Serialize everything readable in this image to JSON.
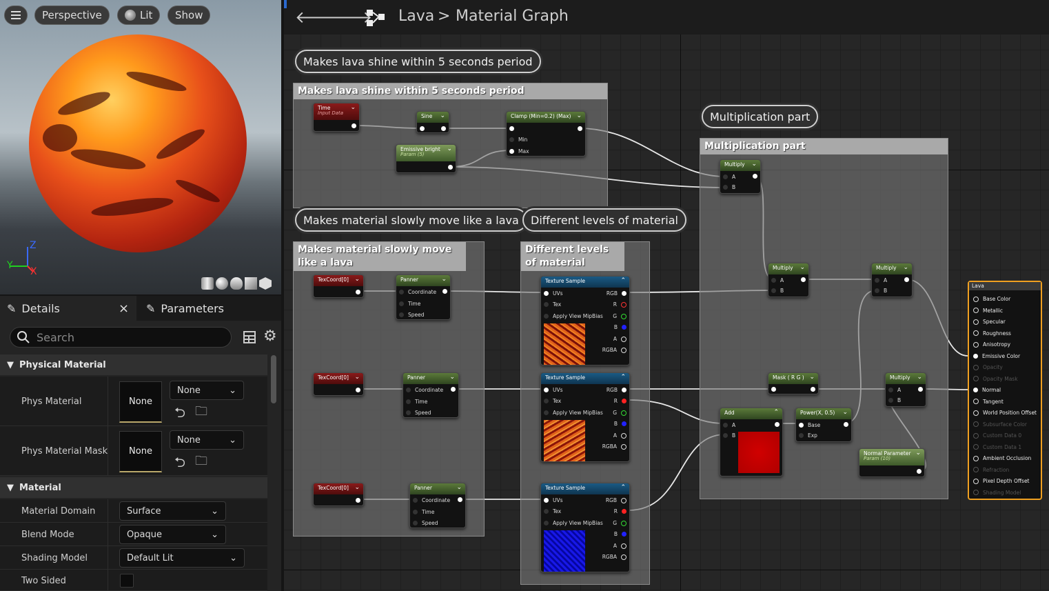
{
  "viewport": {
    "menu_icon": "hamburger-icon",
    "perspective_label": "Perspective",
    "lit_label": "Lit",
    "show_label": "Show",
    "axis": {
      "z": "Z",
      "y": "Y",
      "x": "X"
    }
  },
  "details": {
    "details_tab": "Details",
    "close_glyph": "×",
    "parameters_tab": "Parameters",
    "search_placeholder": "Search",
    "sections": {
      "physical": "Physical Material",
      "material": "Material"
    },
    "props": {
      "phys_material": {
        "label": "Phys Material",
        "thumb": "None",
        "value": "None"
      },
      "phys_material_mask": {
        "label": "Phys Material Mask",
        "thumb": "None",
        "value": "None"
      },
      "material_domain": {
        "label": "Material Domain",
        "value": "Surface"
      },
      "blend_mode": {
        "label": "Blend Mode",
        "value": "Opaque"
      },
      "shading_model": {
        "label": "Shading Model",
        "value": "Default Lit"
      },
      "two_sided": {
        "label": "Two Sided",
        "checked": false
      }
    }
  },
  "graph": {
    "crumb_asset": "Lava",
    "crumb_sep": ">",
    "crumb_page": "Material Graph",
    "comments": {
      "shine": "Makes lava shine within 5 seconds period",
      "mult": "Multiplication part",
      "move": "Makes material slowly move like a lava",
      "levels": "Different levels of material",
      "move_head": "Makes material slowly move like a lava",
      "levels_head": "Different levels of material"
    },
    "nodes": {
      "time": {
        "title": "Time",
        "sub": "Input Data"
      },
      "sine": {
        "title": "Sine"
      },
      "clamp": {
        "title": "Clamp (Min=0.2) (Max)",
        "min": "Min",
        "max": "Max"
      },
      "emissive": {
        "title": "Emissive bright",
        "sub": "Param (5)"
      },
      "texcoord": "TexCoord[0]",
      "panner": {
        "title": "Panner",
        "coordinate": "Coordinate",
        "time": "Time",
        "speed": "Speed"
      },
      "texsample": {
        "title": "Texture Sample",
        "uvs": "UVs",
        "tex": "Tex",
        "mip": "Apply View MipBias",
        "rgb": "RGB",
        "r": "R",
        "g": "G",
        "b": "B",
        "a": "A",
        "rgba": "RGBA"
      },
      "multiply": {
        "title": "Multiply",
        "a": "A",
        "b": "B"
      },
      "mask": {
        "title": "Mask ( R G )"
      },
      "add": {
        "title": "Add",
        "a": "A",
        "b": "B"
      },
      "power": {
        "title": "Power(X, 0.5)",
        "base": "Base",
        "exp": "Exp"
      },
      "normal_param": {
        "title": "Normal Parameter",
        "sub": "Param (10)"
      }
    },
    "result": {
      "title": "Lava",
      "inputs": [
        "Base Color",
        "Metallic",
        "Specular",
        "Roughness",
        "Anisotropy",
        "Emissive Color",
        "Opacity",
        "Opacity Mask",
        "Normal",
        "Tangent",
        "World Position Offset",
        "Subsurface Color",
        "Custom Data 0",
        "Custom Data 1",
        "Ambient Occlusion",
        "Refraction",
        "Pixel Depth Offset",
        "Shading Model"
      ],
      "disabled": [
        6,
        7,
        11,
        12,
        13,
        15,
        17
      ]
    },
    "colors": {
      "accent": "#f0a020",
      "texture_lava": "#d8501a",
      "texture_red": "#c00000",
      "texture_blue": "#1010d0"
    }
  }
}
